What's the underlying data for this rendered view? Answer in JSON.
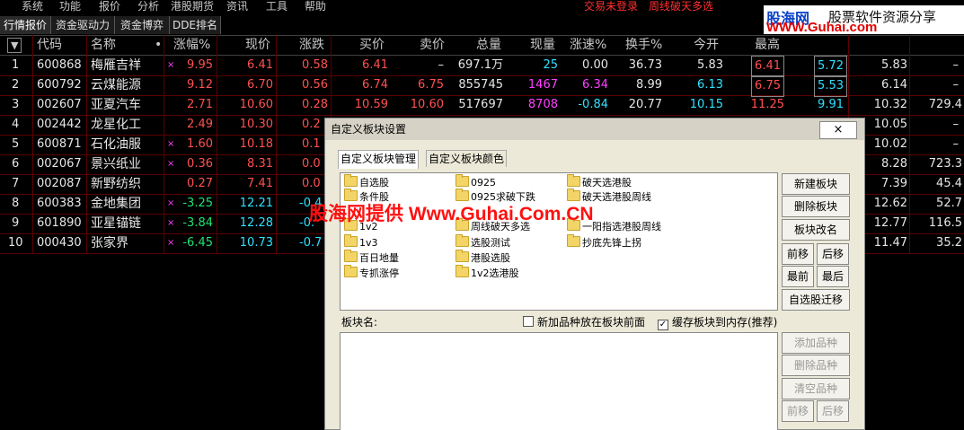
{
  "menu": [
    "系统",
    "功能",
    "报价",
    "分析",
    "港股期货",
    "资讯",
    "工具",
    "帮助"
  ],
  "status": {
    "trade": "交易未登录",
    "signal": "周线破天多选"
  },
  "tabs": [
    "行情报价",
    "资金驱动力",
    "资金博弈",
    "DDE排名"
  ],
  "logo": {
    "cn": "股海网",
    "tag": "股票软件资源分享",
    "url": "WWW.Guhai.com"
  },
  "headers": [
    "▼",
    "代码",
    "名称",
    "•",
    "涨幅%",
    "现价",
    "涨跌",
    "买价",
    "卖价",
    "总量",
    "现量",
    "涨速%",
    "换手%",
    "今开",
    "最高"
  ],
  "rows": [
    {
      "idx": "1",
      "code": "600868",
      "name": "梅雁吉祥",
      "mark": "×",
      "pct": "9.95",
      "price": "6.41",
      "chg": "0.58",
      "bid": "6.41",
      "ask": "–",
      "vol": "697.1万",
      "cur": "25",
      "spd": "0.00",
      "turn": "36.73",
      "open": "5.83",
      "high": "6.41",
      "c2": "5.72",
      "c3": "5.83",
      "c4": "–"
    },
    {
      "idx": "2",
      "code": "600792",
      "name": "云煤能源",
      "mark": "",
      "pct": "9.12",
      "price": "6.70",
      "chg": "0.56",
      "bid": "6.74",
      "ask": "6.75",
      "vol": "855745",
      "cur": "1467",
      "spd": "6.34",
      "turn": "8.99",
      "open": "6.13",
      "high": "6.75",
      "c2": "5.53",
      "c3": "6.14",
      "c4": "–"
    },
    {
      "idx": "3",
      "code": "002607",
      "name": "亚夏汽车",
      "mark": "",
      "pct": "2.71",
      "price": "10.60",
      "chg": "0.28",
      "bid": "10.59",
      "ask": "10.60",
      "vol": "517697",
      "cur": "8708",
      "spd": "-0.84",
      "turn": "20.77",
      "open": "10.15",
      "high": "11.25",
      "c2": "9.91",
      "c3": "10.32",
      "c4": "729.4"
    },
    {
      "idx": "4",
      "code": "002442",
      "name": "龙星化工",
      "mark": "",
      "pct": "2.49",
      "price": "10.30",
      "chg": "0.2",
      "c3": "10.05",
      "c4": "–"
    },
    {
      "idx": "5",
      "code": "600871",
      "name": "石化油服",
      "mark": "×",
      "pct": "1.60",
      "price": "10.18",
      "chg": "0.1",
      "c3": "10.02",
      "c4": "–"
    },
    {
      "idx": "6",
      "code": "002067",
      "name": "景兴纸业",
      "mark": "×",
      "pct": "0.36",
      "price": "8.31",
      "chg": "0.0",
      "c3": "8.28",
      "c4": "723.3"
    },
    {
      "idx": "7",
      "code": "002087",
      "name": "新野纺织",
      "mark": "",
      "pct": "0.27",
      "price": "7.41",
      "chg": "0.0",
      "c3": "7.39",
      "c4": "45.4"
    },
    {
      "idx": "8",
      "code": "600383",
      "name": "金地集团",
      "mark": "×",
      "pct": "-3.25",
      "price": "12.21",
      "chg": "-0.4",
      "c3": "12.62",
      "c4": "52.7"
    },
    {
      "idx": "9",
      "code": "601890",
      "name": "亚星锚链",
      "mark": "×",
      "pct": "-3.84",
      "price": "12.28",
      "chg": "-0.",
      "c3": "12.77",
      "c4": "116.5"
    },
    {
      "idx": "10",
      "code": "000430",
      "name": "张家界",
      "mark": "×",
      "pct": "-6.45",
      "price": "10.73",
      "chg": "-0.7",
      "c3": "11.47",
      "c4": "35.2"
    }
  ],
  "overlay": "股海网提供 Www.Guhai.Com.CN",
  "dialog": {
    "title": "自定义板块设置",
    "close": "×",
    "tabs": [
      "自定义板块管理",
      "自定义板块颜色"
    ],
    "folders_col1": [
      "自选股",
      "条件股",
      "",
      "1v2",
      "1v3",
      "百日地量",
      "专抓涨停"
    ],
    "folders_col2": [
      "0925",
      "0925求破下跌",
      "",
      "周线破天多选",
      "选股测试",
      "港股选股",
      "1v2选港股"
    ],
    "folders_col3": [
      "破天选港股",
      "破天选港股周线",
      "",
      "一阳指选港股周线",
      "抄底先锋上拐"
    ],
    "buttons": {
      "new": "新建板块",
      "del": "删除板块",
      "rename": "板块改名",
      "up": "前移",
      "down": "后移",
      "first": "最前",
      "last": "最后",
      "migrate": "自选股迁移",
      "add": "添加品种",
      "remove": "删除品种",
      "clear": "清空品种",
      "up2": "前移",
      "down2": "后移"
    },
    "label": "板块名:",
    "opt1": "新加品种放在板块前面",
    "opt2": "缓存板块到内存(推荐)",
    "opt2_checked": "✓"
  }
}
